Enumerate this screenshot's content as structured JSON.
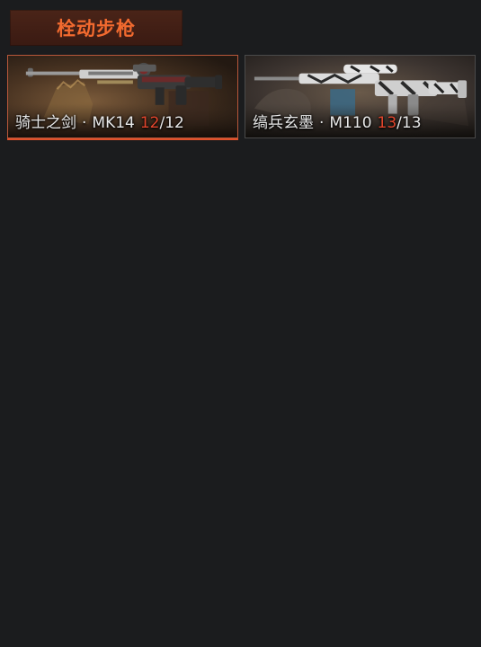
{
  "category": {
    "title": "栓动步枪"
  },
  "skins": [
    {
      "name": "骑士之剑",
      "separator": "·",
      "model": "MK14",
      "owned": "12",
      "total": "/12",
      "selected": true
    },
    {
      "name": "缟兵玄墨",
      "separator": "·",
      "model": "M110",
      "owned": "13",
      "total": "/13",
      "selected": false
    }
  ],
  "colors": {
    "background": "#1b1c1e",
    "accent": "#f26a2f",
    "owned_count": "#e2452c",
    "selected_border": "#e0502a"
  }
}
